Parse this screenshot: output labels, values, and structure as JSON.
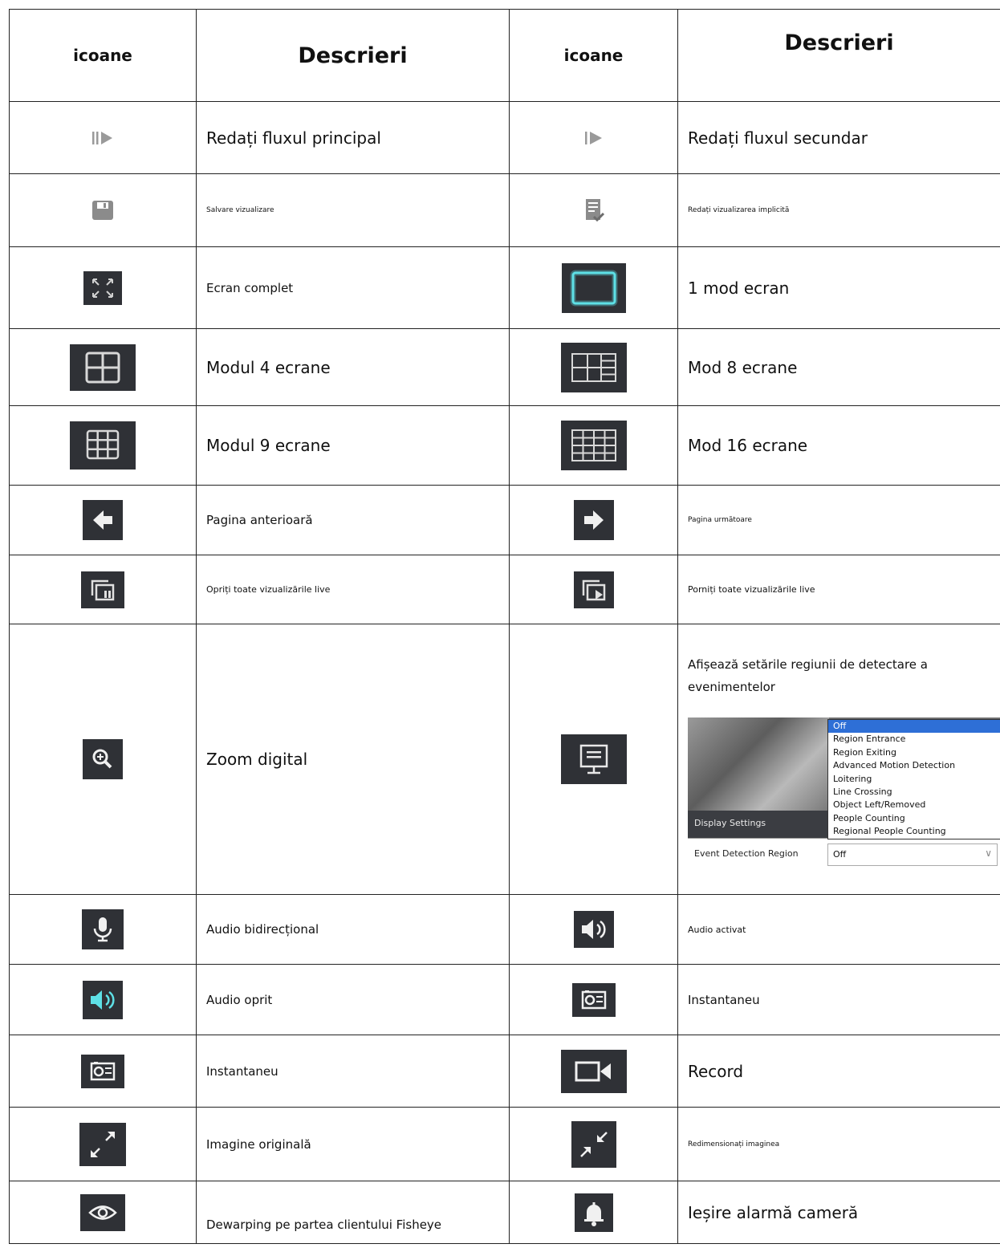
{
  "header": {
    "col_icons": "icoane",
    "col_desc": "Descrieri"
  },
  "rows": [
    {
      "left": {
        "icon": "play-main-stream-icon",
        "desc": "Redați fluxul principal"
      },
      "right": {
        "icon": "play-sub-stream-icon",
        "desc": "Redați fluxul secundar"
      }
    },
    {
      "left": {
        "icon": "save-icon",
        "desc": "Salvare vizualizare"
      },
      "right": {
        "icon": "default-view-icon",
        "desc": "Redați vizualizarea implicită"
      }
    },
    {
      "left": {
        "icon": "fullscreen-icon",
        "desc": "Ecran complet"
      },
      "right": {
        "icon": "one-screen-icon",
        "desc": "1 mod ecran"
      }
    },
    {
      "left": {
        "icon": "four-screen-icon",
        "desc": "Modul 4 ecrane"
      },
      "right": {
        "icon": "eight-screen-icon",
        "desc": "Mod 8 ecrane"
      }
    },
    {
      "left": {
        "icon": "nine-screen-icon",
        "desc": "Modul 9 ecrane"
      },
      "right": {
        "icon": "sixteen-screen-icon",
        "desc": "Mod 16 ecrane"
      }
    },
    {
      "left": {
        "icon": "arrow-left-icon",
        "desc": "Pagina anterioară"
      },
      "right": {
        "icon": "arrow-right-icon",
        "desc": "Pagina următoare"
      }
    },
    {
      "left": {
        "icon": "stop-all-live-icon",
        "desc": "Opriți toate vizualizările live"
      },
      "right": {
        "icon": "start-all-live-icon",
        "desc": "Porniți toate vizualizările live"
      }
    },
    {
      "left": {
        "icon": "zoom-icon",
        "desc": "Zoom digital"
      },
      "right": {
        "icon": "display-settings-icon",
        "desc": "Afișează setările regiunii de detectare a evenimentelor"
      }
    },
    {
      "left": {
        "icon": "microphone-icon",
        "desc": "Audio bidirecțional"
      },
      "right": {
        "icon": "speaker-on-icon",
        "desc": "Audio activat"
      }
    },
    {
      "left": {
        "icon": "speaker-off-icon",
        "desc": "Audio oprit"
      },
      "right": {
        "icon": "snapshot-icon",
        "desc": "Instantaneu"
      }
    },
    {
      "left": {
        "icon": "snapshot-icon",
        "desc": "Instantaneu"
      },
      "right": {
        "icon": "record-icon",
        "desc": "Record"
      }
    },
    {
      "left": {
        "icon": "expand-icon",
        "desc": "Imagine originală"
      },
      "right": {
        "icon": "shrink-icon",
        "desc": "Redimensionați imaginea"
      }
    },
    {
      "left": {
        "icon": "eye-icon",
        "desc": "Dewarping pe partea clientului Fisheye"
      },
      "right": {
        "icon": "bell-icon",
        "desc": "Ieșire alarmă cameră"
      }
    }
  ],
  "detection_screenshot": {
    "options": [
      "Off",
      "Region Entrance",
      "Region Exiting",
      "Advanced Motion Detection",
      "Loitering",
      "Line Crossing",
      "Object Left/Removed",
      "People Counting",
      "Regional People Counting"
    ],
    "panel_title": "Display Settings",
    "field_label": "Event Detection Region",
    "field_value": "Off"
  },
  "colors": {
    "icon_bg": "#2f3136",
    "accent": "#5ee0e6",
    "selected": "#2e6fd6"
  }
}
